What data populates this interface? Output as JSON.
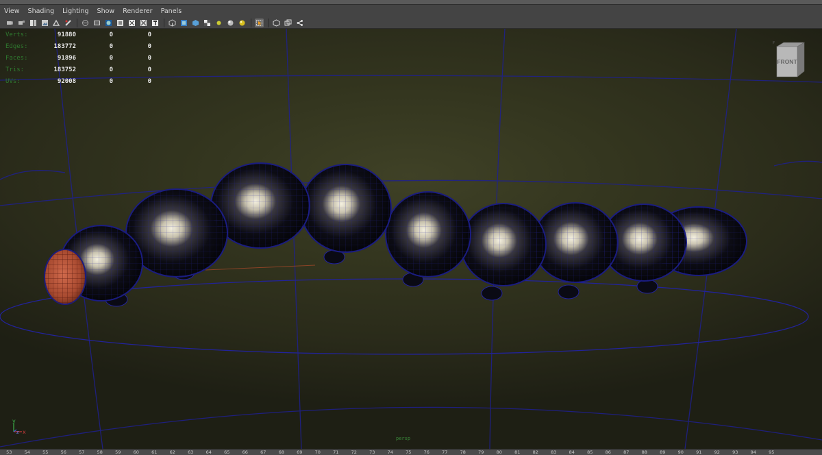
{
  "menu": [
    "View",
    "Shading",
    "Lighting",
    "Show",
    "Renderer",
    "Panels"
  ],
  "toolbar_icons": [
    "camera-select-icon",
    "camera-attributes-icon",
    "bookmark-icon",
    "image-plane-icon",
    "2d-pan-zoom-icon",
    "grease-pencil-icon",
    "wireframe-icon",
    "smooth-shade-icon",
    "default-material-icon",
    "bounding-box-icon",
    "xray-icon",
    "wireframe-on-shaded-icon",
    "textured-icon",
    "use-all-lights-icon",
    "shadows-icon",
    "screen-space-ao-icon",
    "motion-blur-icon",
    "multisample-aa-icon",
    "depth-of-field-icon",
    "isolate-select-icon",
    "xray-joints-icon",
    "xray-active-icon",
    "snapshot-icon"
  ],
  "hud": {
    "labels": [
      "Verts:",
      "Edges:",
      "Faces:",
      "Tris:",
      "UVs:"
    ],
    "rows": [
      [
        "91880",
        "0",
        "0"
      ],
      [
        "183772",
        "0",
        "0"
      ],
      [
        "91896",
        "0",
        "0"
      ],
      [
        "183752",
        "0",
        "0"
      ],
      [
        "92008",
        "0",
        "0"
      ]
    ]
  },
  "viewcube": {
    "label": "FRONT"
  },
  "axis": {
    "y": "y",
    "z": "z",
    "x": "x"
  },
  "camera_label": "persp",
  "timeline_ticks": [
    "53",
    "54",
    "55",
    "56",
    "57",
    "58",
    "59",
    "60",
    "61",
    "62",
    "63",
    "64",
    "65",
    "66",
    "67",
    "68",
    "69",
    "70",
    "71",
    "72",
    "73",
    "74",
    "75",
    "76",
    "77",
    "78",
    "79",
    "80",
    "81",
    "82",
    "83",
    "84",
    "85",
    "86",
    "87",
    "88",
    "89",
    "90",
    "91",
    "92",
    "93",
    "94",
    "95"
  ],
  "colors": {
    "wireframe": "#22239a",
    "hud_green": "#2f7a2f",
    "head": "#c0583c"
  }
}
